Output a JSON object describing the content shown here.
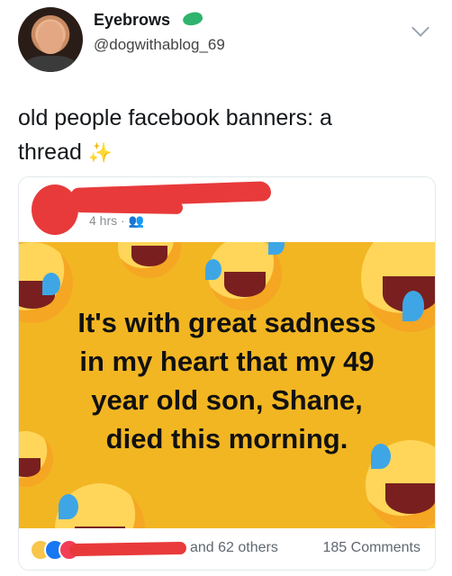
{
  "tweet": {
    "name": "Eyebrows",
    "handle": "@dogwithablog_69",
    "text_line1": "old people facebook banners: a",
    "text_line2": "thread",
    "sparkle": "✨"
  },
  "facebook_post": {
    "timestamp": "4 hrs · ",
    "banner_lines": [
      "It's with great sadness",
      "in my heart that my 49",
      "year old son, Shane,",
      "died this morning."
    ],
    "reactions_others": "and 62 others",
    "comments_count": "185 Comments"
  },
  "colors": {
    "banner_background": "#f2b623",
    "redaction": "#e83a3a",
    "verified_badge": "#2fb36d"
  },
  "icons": {
    "verified": "verified-badge-icon",
    "more": "chevron-down-icon",
    "reactions": [
      "sad-reaction-icon",
      "like-reaction-icon",
      "love-reaction-icon"
    ]
  }
}
